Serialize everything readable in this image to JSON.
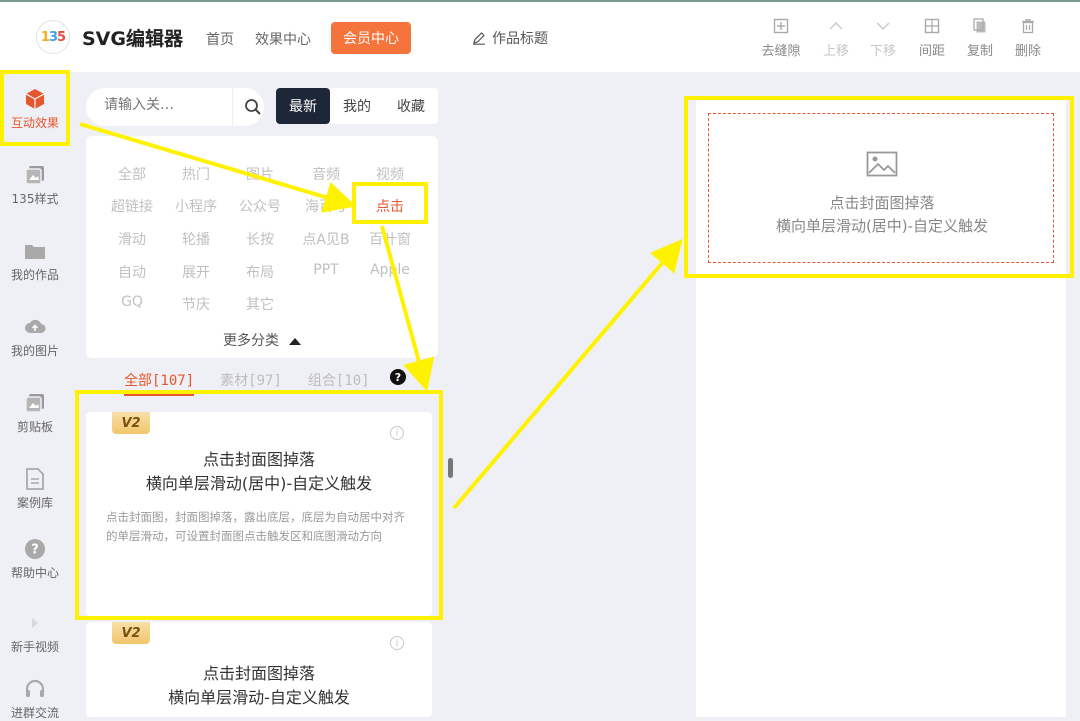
{
  "header": {
    "logo_text": "135",
    "app_title": "SVG编辑器",
    "nav": [
      "首页",
      "效果中心"
    ],
    "vip_label": "会员中心",
    "doc_title": "作品标题",
    "tools": [
      {
        "label": "去缝隙",
        "icon": "plus-square-icon",
        "enabled": true
      },
      {
        "label": "上移",
        "icon": "chevron-up-icon",
        "enabled": false
      },
      {
        "label": "下移",
        "icon": "chevron-down-icon",
        "enabled": false
      },
      {
        "label": "间距",
        "icon": "spacing-icon",
        "enabled": true
      },
      {
        "label": "复制",
        "icon": "copy-icon",
        "enabled": true
      },
      {
        "label": "删除",
        "icon": "trash-icon",
        "enabled": true
      }
    ]
  },
  "sidebar": {
    "items": [
      {
        "label": "互动效果",
        "icon": "cube-icon",
        "active": true
      },
      {
        "label": "135样式",
        "icon": "style-icon"
      },
      {
        "label": "我的作品",
        "icon": "folder-icon"
      },
      {
        "label": "我的图片",
        "icon": "cloud-upload-icon"
      },
      {
        "label": "剪贴板",
        "icon": "clipboard-icon"
      },
      {
        "label": "案例库",
        "icon": "document-icon"
      },
      {
        "label": "帮助中心",
        "icon": "help-icon"
      },
      {
        "label": "新手视频",
        "icon": "video-icon"
      },
      {
        "label": "进群交流",
        "icon": "headset-icon"
      }
    ]
  },
  "panel": {
    "search_placeholder": "请输入关…",
    "segments": [
      "最新",
      "我的",
      "收藏"
    ],
    "active_segment": "最新",
    "categories": [
      [
        "全部",
        "热门",
        "图片",
        "音频",
        "视频"
      ],
      [
        "超链接",
        "小程序",
        "公众号",
        "海百号",
        "点击"
      ],
      [
        "滑动",
        "轮播",
        "长按",
        "点A见B",
        "百叶窗"
      ],
      [
        "自动",
        "展开",
        "布局",
        "PPT",
        "Apple"
      ],
      [
        "GQ",
        "节庆",
        "其它"
      ]
    ],
    "active_category": "点击",
    "more_label": "更多分类",
    "filters": [
      "全部[107]",
      "素材[97]",
      "组合[10]"
    ],
    "help_badge": "?",
    "cards": [
      {
        "badge": "V2",
        "title_line1": "点击封面图掉落",
        "title_line2": "横向单层滑动(居中)-自定义触发",
        "desc": "点击封面图，封面图掉落，露出底层，底层为自动居中对齐的单层滑动，可设置封面图点击触发区和底图滑动方向"
      },
      {
        "badge": "V2",
        "title_line1": "点击封面图掉落",
        "title_line2": "横向单层滑动-自定义触发",
        "desc": ""
      }
    ]
  },
  "canvas": {
    "placeholder_line1": "点击封面图掉落",
    "placeholder_line2": "横向单层滑动(居中)-自定义触发",
    "placeholder_icon": "image-icon"
  },
  "colors": {
    "accent": "#e8562e",
    "vip": "#f4743b",
    "highlight": "#fff200",
    "dark": "#1e2738"
  }
}
